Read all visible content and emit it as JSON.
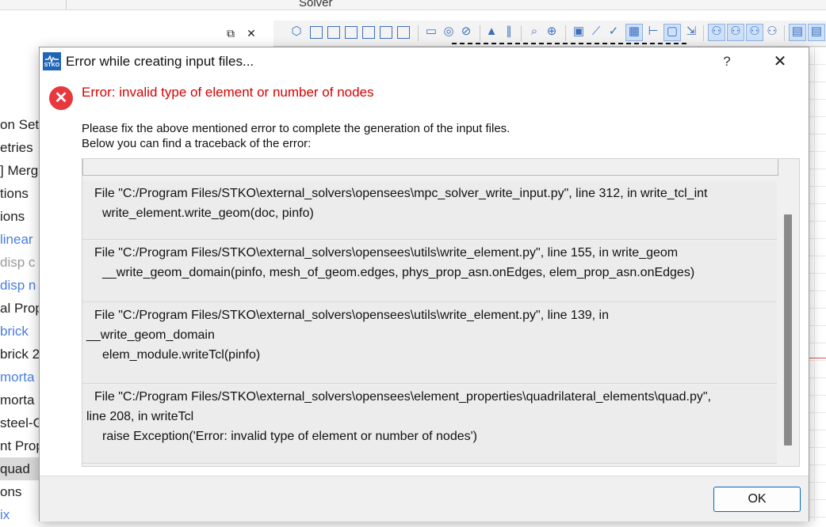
{
  "background": {
    "top_label": "Solver",
    "panel_buttons": [
      "restore-icon",
      "close-icon"
    ],
    "tree_items": [
      {
        "label": "on Sets",
        "style": "normal"
      },
      {
        "label": "etries",
        "style": "normal"
      },
      {
        "label": "] Merg",
        "style": "normal"
      },
      {
        "label": "tions",
        "style": "normal"
      },
      {
        "label": "ions",
        "style": "normal"
      },
      {
        "label": "linear",
        "style": "blue"
      },
      {
        "label": "disp c",
        "style": "grey"
      },
      {
        "label": "disp n",
        "style": "blue"
      },
      {
        "label": "al Prop",
        "style": "normal"
      },
      {
        "label": "brick",
        "style": "blue"
      },
      {
        "label": "brick 2",
        "style": "normal"
      },
      {
        "label": "morta",
        "style": "blue"
      },
      {
        "label": "morta",
        "style": "normal"
      },
      {
        "label": "steel-G",
        "style": "normal"
      },
      {
        "label": "nt Prop",
        "style": "normal"
      },
      {
        "label": "quad",
        "style": "selected"
      },
      {
        "label": "ons",
        "style": "normal"
      },
      {
        "label": "ix",
        "style": "blue"
      }
    ]
  },
  "dialog": {
    "title": "Error while creating input files...",
    "app_icon_text": "STKO",
    "help_label": "?",
    "close_label": "✕",
    "error_heading": "Error: invalid type of element or number of nodes",
    "explanation_line1": "Please fix the above mentioned error to complete the generation of the input files.",
    "explanation_line2": "Below you can find a traceback of the error:",
    "traceback": [
      {
        "line1": "File \"C:/Program Files/STKO\\external_solvers\\opensees\\mpc_solver_write_input.py\", line 312, in write_tcl_int",
        "line2": "",
        "line3": "write_element.write_geom(doc, pinfo)"
      },
      {
        "line1": "File \"C:/Program Files/STKO\\external_solvers\\opensees\\utils\\write_element.py\", line 155, in write_geom",
        "line2": "",
        "line3": "__write_geom_domain(pinfo, mesh_of_geom.edges,  phys_prop_asn.onEdges, elem_prop_asn.onEdges)"
      },
      {
        "line1": "File \"C:/Program Files/STKO\\external_solvers\\opensees\\utils\\write_element.py\", line 139, in",
        "line2": "__write_geom_domain",
        "line3": "elem_module.writeTcl(pinfo)"
      },
      {
        "line1": "File \"C:/Program Files/STKO\\external_solvers\\opensees\\element_properties\\quadrilateral_elements\\quad.py\",",
        "line2": "line 208, in writeTcl",
        "line3": "raise Exception('Error: invalid type of element or number of nodes')"
      }
    ],
    "ok_label": "OK"
  },
  "colors": {
    "error_red": "#d80000",
    "accent_blue": "#0067c0"
  }
}
